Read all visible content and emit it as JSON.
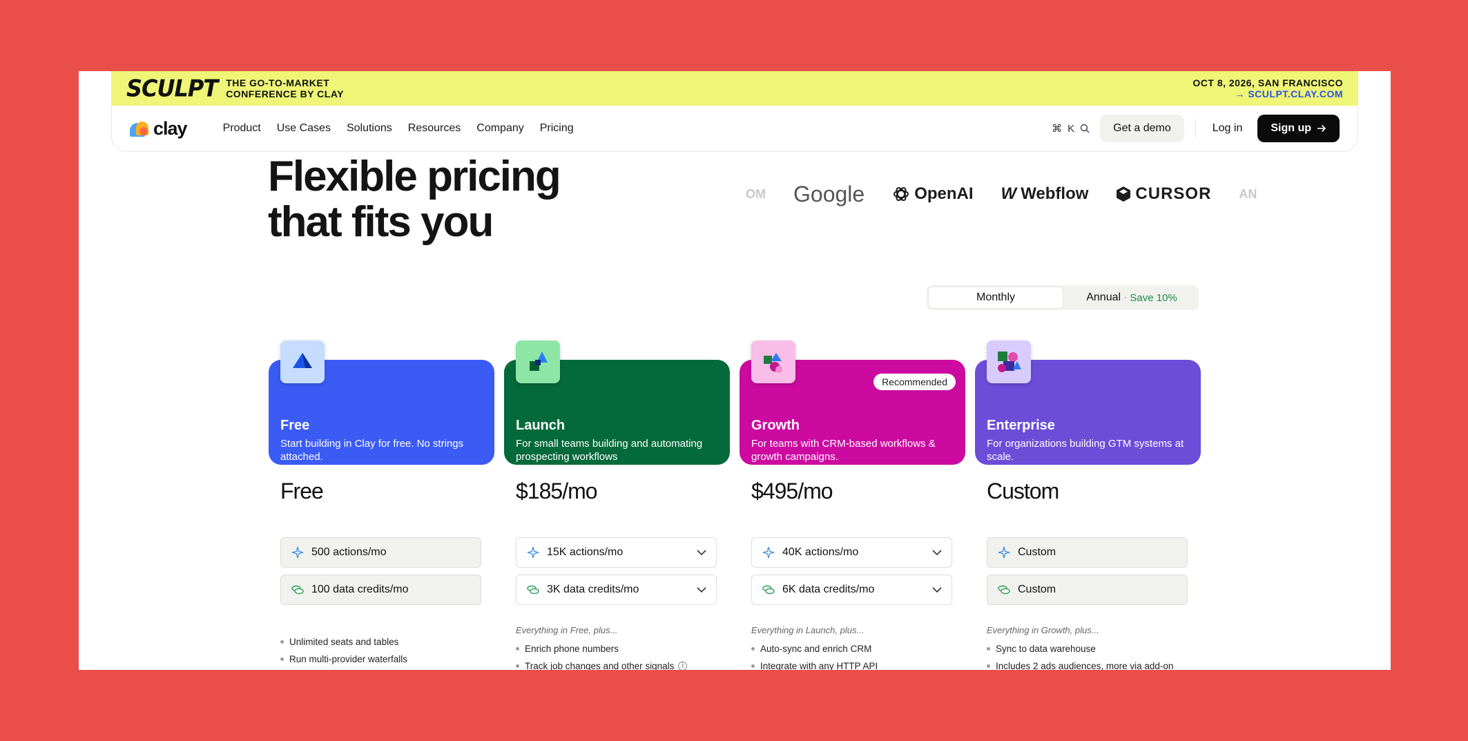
{
  "banner": {
    "logo": "SCULPT",
    "tagline_line1": "THE GO-TO-MARKET",
    "tagline_line2": "CONFERENCE BY CLAY",
    "event_date": "OCT 8, 2026, SAN FRANCISCO",
    "event_link": "→ SCULPT.CLAY.COM",
    "background_color": "#eef577"
  },
  "nav": {
    "logo_text": "clay",
    "links": [
      "Product",
      "Use Cases",
      "Solutions",
      "Resources",
      "Company",
      "Pricing"
    ],
    "shortcut_key": "K",
    "demo_label": "Get a demo",
    "login_label": "Log in",
    "signup_label": "Sign up"
  },
  "hero": {
    "title_line1": "Flexible pricing",
    "title_line2": "that fits you"
  },
  "customer_logos": [
    "OM",
    "Google",
    "OpenAI",
    "Webflow",
    "CURSOR",
    "AN"
  ],
  "billing": {
    "monthly_label": "Monthly",
    "annual_label": "Annual",
    "annual_separator": "·",
    "annual_save": "Save 10%",
    "selected": "Monthly"
  },
  "plans": [
    {
      "name": "Free",
      "description": "Start building in Clay for free. No strings attached.",
      "price": "Free",
      "actions": "500 actions/mo",
      "credits": "100 data credits/mo",
      "plus_label": "",
      "features": [
        "Unlimited seats and tables",
        "Run multi-provider waterfalls"
      ],
      "color": "#3b5bf5",
      "icon_bg": "#c6ddff"
    },
    {
      "name": "Launch",
      "description": "For small teams building and automating prospecting workflows",
      "price": "$185/mo",
      "actions": "15K actions/mo",
      "credits": "3K data credits/mo",
      "plus_label": "Everything in Free, plus...",
      "features": [
        "Enrich phone numbers",
        "Track job changes and other signals"
      ],
      "color": "#056a3b",
      "icon_bg": "#8ee6a6"
    },
    {
      "name": "Growth",
      "description": "For teams with CRM-based workflows & growth campaigns.",
      "price": "$495/mo",
      "actions": "40K actions/mo",
      "credits": "6K data credits/mo",
      "plus_label": "Everything in Launch, plus...",
      "features": [
        "Auto-sync and enrich CRM",
        "Integrate with any HTTP API"
      ],
      "badge": "Recommended",
      "color": "#cc0aa0",
      "icon_bg": "#f8bde8"
    },
    {
      "name": "Enterprise",
      "description": "For organizations building GTM systems at scale.",
      "price": "Custom",
      "actions": "Custom",
      "credits": "Custom",
      "plus_label": "Everything in Growth, plus...",
      "features": [
        "Sync to data warehouse",
        "Includes 2 ads audiences, more via add-on"
      ],
      "color": "#6c4dd8",
      "icon_bg": "#d8ccff"
    }
  ]
}
